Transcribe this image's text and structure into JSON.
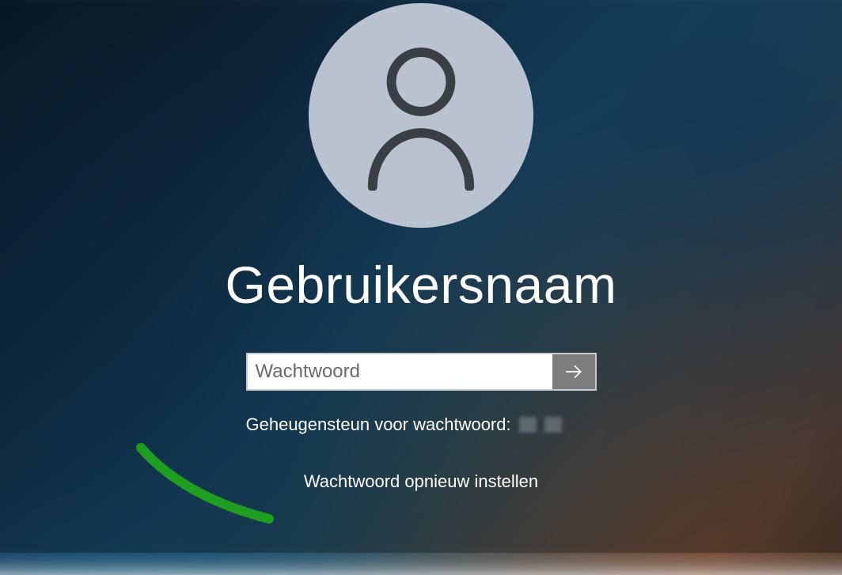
{
  "login": {
    "username": "Gebruikersnaam",
    "password_placeholder": "Wachtwoord",
    "password_value": "",
    "hint_label": "Geheugensteun voor wachtwoord:",
    "reset_link": "Wachtwoord opnieuw instellen"
  },
  "icons": {
    "avatar": "user-icon",
    "submit": "arrow-right-icon"
  },
  "colors": {
    "avatar_bg": "#b8c3cf",
    "avatar_stroke": "#3a3f45",
    "submit_bg": "#7d7d7d",
    "annotation_arrow": "#1e9e1e"
  }
}
